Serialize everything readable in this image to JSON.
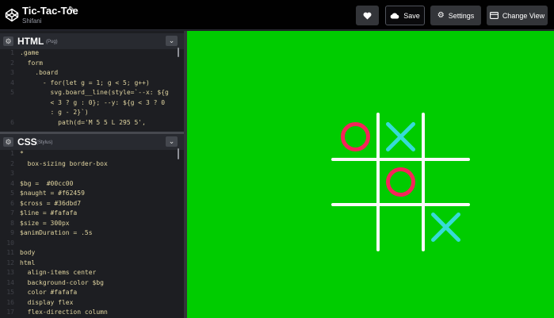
{
  "app": {
    "title": "Tic-Tac-Toe",
    "author": "Shifani"
  },
  "toolbar": {
    "like_icon": "heart-icon",
    "save_label": "Save",
    "settings_label": "Settings",
    "change_view_label": "Change View"
  },
  "html_pane": {
    "language": "HTML",
    "preprocessor": "(Pug)",
    "lines": [
      {
        "n": "1",
        "text": ".game"
      },
      {
        "n": "2",
        "text": "  form"
      },
      {
        "n": "3",
        "text": "    .board"
      },
      {
        "n": "4",
        "text": "      - for(let g = 1; g < 5; g++)"
      },
      {
        "n": "5",
        "text": "        svg.board__line(style=`--x: ${g"
      },
      {
        "n": "",
        "text": "        < 3 ? g : 0}; --y: ${g < 3 ? 0"
      },
      {
        "n": "",
        "text": "        : g - 2}`)"
      },
      {
        "n": "6",
        "text": "          path(d='M 5 5 L 295 5',"
      }
    ]
  },
  "css_pane": {
    "language": "CSS",
    "preprocessor": "(Stylus)",
    "lines": [
      {
        "n": "1",
        "text": "*"
      },
      {
        "n": "2",
        "text": "  box-sizing border-box"
      },
      {
        "n": "3",
        "text": ""
      },
      {
        "n": "4",
        "text": "$bg =  #00cc00"
      },
      {
        "n": "5",
        "text": "$naught = #f62459"
      },
      {
        "n": "6",
        "text": "$cross = #36dbd7"
      },
      {
        "n": "7",
        "text": "$line = #fafafa"
      },
      {
        "n": "8",
        "text": "$size = 300px"
      },
      {
        "n": "9",
        "text": "$animDuration = .5s"
      },
      {
        "n": "10",
        "text": ""
      },
      {
        "n": "11",
        "text": "body"
      },
      {
        "n": "12",
        "text": "html"
      },
      {
        "n": "13",
        "text": "  align-items center"
      },
      {
        "n": "14",
        "text": "  background-color $bg"
      },
      {
        "n": "15",
        "text": "  color #fafafa"
      },
      {
        "n": "16",
        "text": "  display flex"
      },
      {
        "n": "17",
        "text": "  flex-direction column"
      }
    ]
  },
  "preview": {
    "background": "#00cc00",
    "line_color": "#fafafa",
    "naught_color": "#f62459",
    "cross_color": "#36dbd7",
    "cells": [
      "O",
      "X",
      "",
      "",
      "O",
      "",
      "",
      "",
      "X"
    ]
  }
}
